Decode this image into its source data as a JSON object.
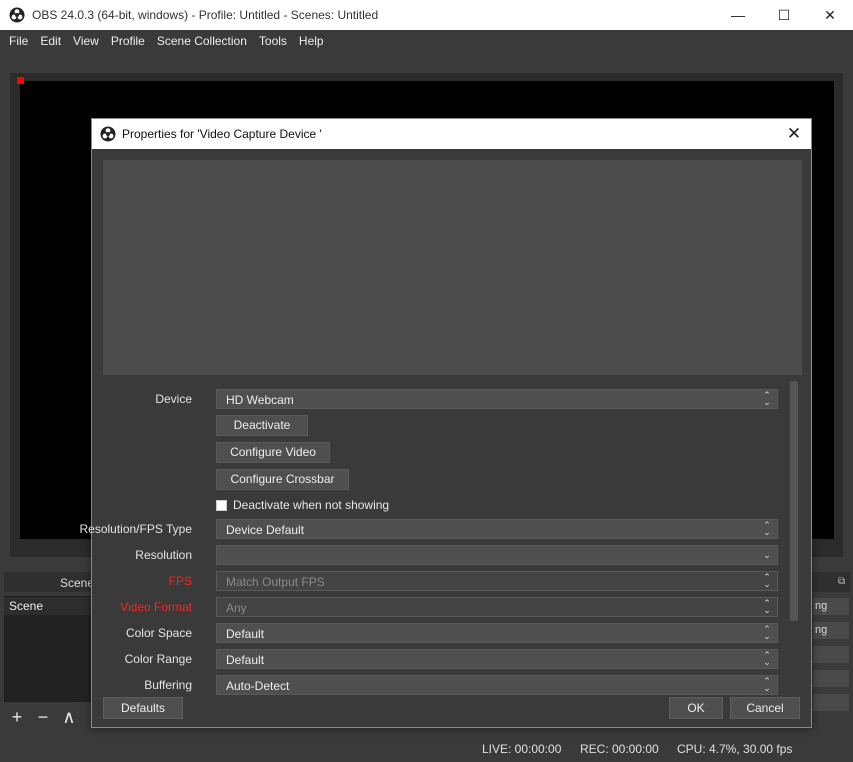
{
  "main_window": {
    "title": "OBS 24.0.3 (64-bit, windows) - Profile: Untitled - Scenes: Untitled",
    "controls": {
      "minimize": "—",
      "maximize": "☐",
      "close": "✕"
    }
  },
  "menu": [
    "File",
    "Edit",
    "View",
    "Profile",
    "Scene Collection",
    "Tools",
    "Help"
  ],
  "docks": {
    "scenes_title": "Scenes",
    "scene_item": "Scene",
    "toolbar": {
      "add": "+",
      "remove": "−",
      "up": "∧"
    },
    "right_buttons": [
      "ng",
      "ng"
    ]
  },
  "status": {
    "live": "LIVE: 00:00:00",
    "rec": "REC: 00:00:00",
    "cpu": "CPU: 4.7%, 30.00 fps"
  },
  "dialog": {
    "title": "Properties for 'Video Capture Device '",
    "close": "✕",
    "device_label": "Device",
    "device_value": "HD Webcam",
    "deactivate_button": "Deactivate",
    "configure_video_button": "Configure Video",
    "configure_crossbar_button": "Configure Crossbar",
    "deactivate_when_not_showing": "Deactivate when not showing",
    "resolution_fps_type_label": "Resolution/FPS Type",
    "resolution_fps_type_value": "Device Default",
    "resolution_label": "Resolution",
    "resolution_value": "",
    "fps_label": "FPS",
    "fps_value": "Match Output FPS",
    "video_format_label": "Video Format",
    "video_format_value": "Any",
    "color_space_label": "Color Space",
    "color_space_value": "Default",
    "color_range_label": "Color Range",
    "color_range_value": "Default",
    "buffering_label": "Buffering",
    "buffering_value": "Auto-Detect",
    "defaults_button": "Defaults",
    "ok_button": "OK",
    "cancel_button": "Cancel"
  },
  "colors": {
    "background": "#3a3a3a",
    "preview": "#000000",
    "warning_label": "#ff2020"
  }
}
